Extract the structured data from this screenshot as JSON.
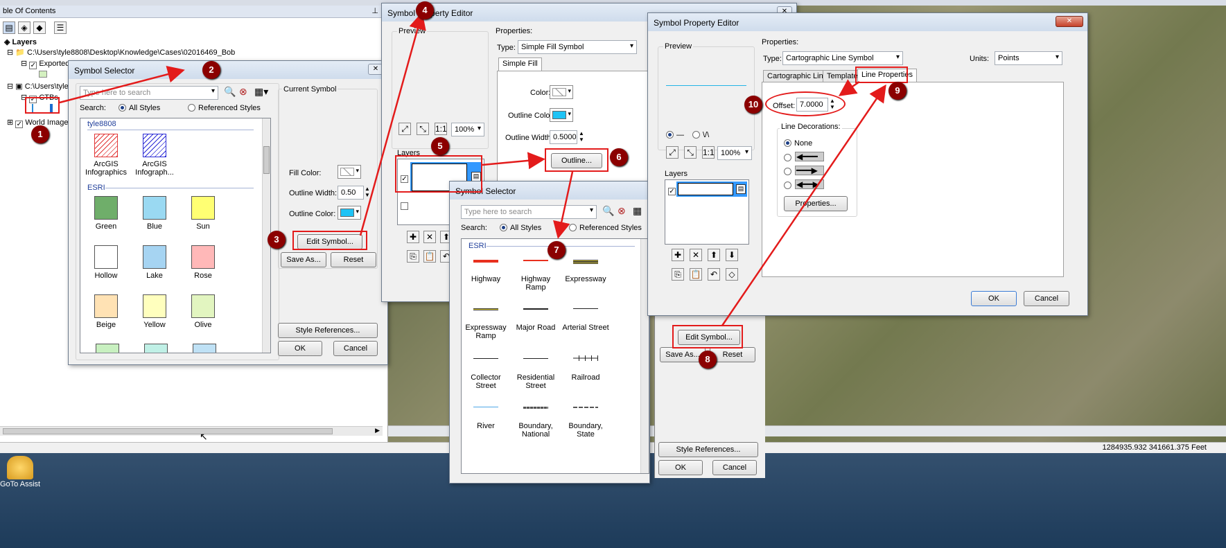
{
  "toc": {
    "title": "ble Of Contents",
    "layers_label": "Layers",
    "items": [
      {
        "label": "C:\\Users\\tyle8808\\Desktop\\Knowledge\\Cases\\02016469_Bob"
      },
      {
        "label": "Exported"
      },
      {
        "label": "C:\\Users\\tyle"
      },
      {
        "label": "CTBs"
      },
      {
        "label": "World Image"
      }
    ]
  },
  "symbol_selector_1": {
    "title": "Symbol Selector",
    "search_placeholder": "Type here to search",
    "search_label": "Search:",
    "all_styles": "All Styles",
    "referenced_styles": "Referenced Styles",
    "section_user": "tyle8808",
    "section_esri": "ESRI",
    "symbols": [
      {
        "label": "ArcGIS Infographics",
        "color": "#e23838"
      },
      {
        "label": "ArcGIS Infograph...",
        "color": "#2b2bd6"
      },
      {
        "label": "Green",
        "color": "#6fae6a"
      },
      {
        "label": "Blue",
        "color": "#9ad9f2"
      },
      {
        "label": "Sun",
        "color": "#ffff73"
      },
      {
        "label": "Hollow",
        "color": "#ffffff"
      },
      {
        "label": "Lake",
        "color": "#a6d4f2"
      },
      {
        "label": "Rose",
        "color": "#ffb8b8"
      },
      {
        "label": "Beige",
        "color": "#ffe2b4"
      },
      {
        "label": "Yellow",
        "color": "#ffffbe"
      },
      {
        "label": "Olive",
        "color": "#e2f5c0"
      }
    ],
    "current_symbol": "Current Symbol",
    "fill_color": "Fill Color:",
    "outline_width_label": "Outline Width:",
    "outline_width": "0.50",
    "outline_color": "Outline Color:",
    "edit_symbol": "Edit Symbol...",
    "save_as": "Save As...",
    "reset": "Reset",
    "style_references": "Style References...",
    "ok": "OK",
    "cancel": "Cancel"
  },
  "property_editor_1": {
    "title": "Symbol Property Editor",
    "preview": "Preview",
    "properties": "Properties:",
    "type_label": "Type:",
    "type_value": "Simple Fill Symbol",
    "tab": "Simple Fill",
    "color": "Color:",
    "outline_color": "Outline Color:",
    "outline_width_label": "Outline Width:",
    "outline_width": "0.5000",
    "outline_button": "Outline...",
    "zoom": "100%",
    "layers": "Layers"
  },
  "symbol_selector_2": {
    "title": "Symbol Selector",
    "search_placeholder": "Type here to search",
    "search_label": "Search:",
    "all_styles": "All Styles",
    "referenced_styles": "Referenced Styles",
    "section_esri": "ESRI",
    "symbols": [
      {
        "label": "Highway"
      },
      {
        "label": "Highway Ramp"
      },
      {
        "label": "Expressway"
      },
      {
        "label": "Expressway Ramp"
      },
      {
        "label": "Major Road"
      },
      {
        "label": "Arterial Street"
      },
      {
        "label": "Collector Street"
      },
      {
        "label": "Residential Street"
      },
      {
        "label": "Railroad"
      },
      {
        "label": "River"
      },
      {
        "label": "Boundary, National"
      },
      {
        "label": "Boundary, State"
      }
    ]
  },
  "property_editor_2": {
    "title": "Symbol Property Editor",
    "preview": "Preview",
    "properties": "Properties:",
    "type_label": "Type:",
    "type_value": "Cartographic Line Symbol",
    "units_label": "Units:",
    "units_value": "Points",
    "tabs": [
      "Cartographic Line",
      "Template",
      "Line Properties"
    ],
    "offset_label": "Offset:",
    "offset_value": "7.0000",
    "line_decorations": "Line Decorations:",
    "none": "None",
    "properties_button": "Properties...",
    "zoom": "100%",
    "layers": "Layers",
    "ok": "OK",
    "cancel": "Cancel"
  },
  "behind_right": {
    "edit_symbol": "Edit Symbol...",
    "save_as": "Save As...",
    "reset": "Reset",
    "style_references": "Style References...",
    "ok": "OK",
    "cancel": "Cancel"
  },
  "status": {
    "coords": "1284935.932  341661.375 Feet"
  },
  "taskbar": {
    "app_label": "GoTo Assist"
  },
  "callouts": [
    "1",
    "2",
    "3",
    "4",
    "5",
    "6",
    "7",
    "8",
    "9",
    "10"
  ],
  "colors": {
    "annotation_red": "#e31b1b",
    "callout_fill": "#8b0000",
    "taskbar": "#1d3b5a",
    "selection_blue": "#3399ff"
  }
}
